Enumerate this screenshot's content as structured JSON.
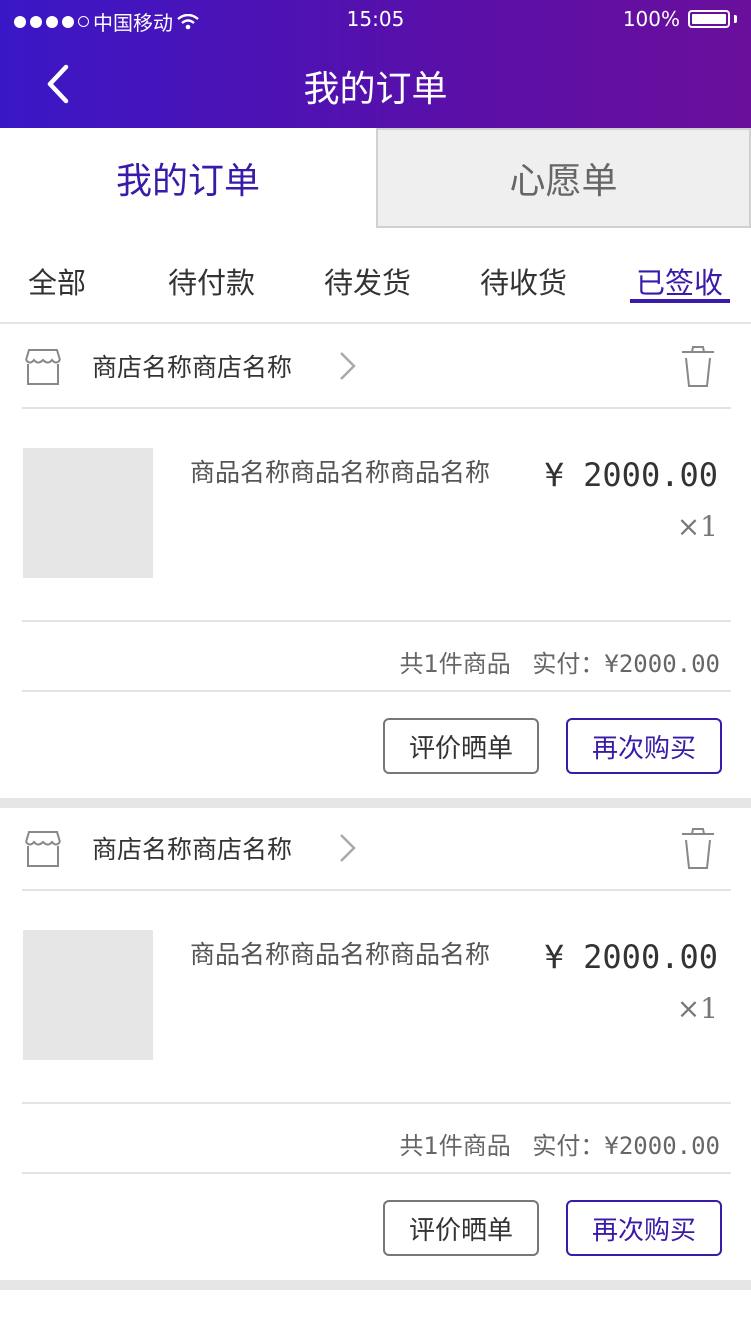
{
  "status_bar": {
    "carrier": "中国移动",
    "time": "15:05",
    "battery": "100%"
  },
  "nav": {
    "title": "我的订单"
  },
  "top_tabs": [
    {
      "label": "我的订单",
      "active": true
    },
    {
      "label": "心愿单",
      "active": false
    }
  ],
  "filters": [
    "全部",
    "待付款",
    "待发货",
    "待收货",
    "已签收"
  ],
  "active_filter": "已签收",
  "orders": [
    {
      "shop_name": "商店名称商店名称",
      "product_name": "商品名称商品名称商品名称",
      "price": "¥ 2000.00",
      "quantity": "×1",
      "summary_count": "共1件商品",
      "summary_paid_label": "实付：",
      "summary_paid_value": "¥2000.00",
      "review_button": "评价晒单",
      "rebuy_button": "再次购买"
    },
    {
      "shop_name": "商店名称商店名称",
      "product_name": "商品名称商品名称商品名称",
      "price": "¥ 2000.00",
      "quantity": "×1",
      "summary_count": "共1件商品",
      "summary_paid_label": "实付：",
      "summary_paid_value": "¥2000.00",
      "review_button": "评价晒单",
      "rebuy_button": "再次购买"
    }
  ],
  "colors": {
    "accent": "#3a1aa8",
    "header_gradient_start": "#3a17c6",
    "header_gradient_end": "#6a0f9c"
  }
}
